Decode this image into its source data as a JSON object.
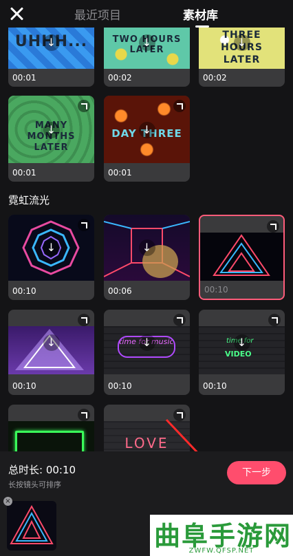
{
  "header": {
    "tabs": [
      {
        "label": "最近项目"
      },
      {
        "label": "素材库"
      }
    ]
  },
  "group1": {
    "items": [
      {
        "title": "UHHH...",
        "duration": "00:01"
      },
      {
        "title": "TWO HOURS LATER",
        "duration": "00:02"
      },
      {
        "title": "THREE HOURS LATER",
        "duration": "00:02"
      },
      {
        "title": "MANY MONTHS LATER",
        "duration": "00:01"
      },
      {
        "title": "DAY THREE",
        "duration": "00:01"
      }
    ]
  },
  "section": {
    "title": "霓虹流光"
  },
  "neon": {
    "items": [
      {
        "duration": "00:10"
      },
      {
        "duration": "00:06"
      },
      {
        "duration": "00:10"
      },
      {
        "duration": "00:10"
      },
      {
        "duration": "00:10"
      },
      {
        "duration": "00:10"
      },
      {
        "duration": ""
      },
      {
        "duration": ""
      }
    ],
    "sign_time_music": "time for music",
    "sign_time_video": "time for",
    "sign_video": "VIDEO",
    "sign_love": "LOVE"
  },
  "bottom": {
    "total_label": "总时长: 00:10",
    "hint": "长按镜头可排序",
    "next_label": "下一步",
    "remove_glyph": "×"
  },
  "watermark": {
    "title": "曲阜手游网",
    "url": "ZWFW.QFSP.NET"
  },
  "colors": {
    "accent": "#ff4d6d",
    "selected_border": "#ff5c7a"
  }
}
